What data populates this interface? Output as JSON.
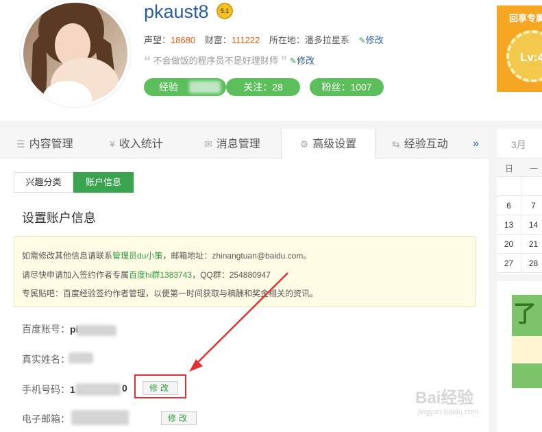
{
  "profile": {
    "username": "pkaust8",
    "level_medal": "5.1",
    "reputation_label": "声望：",
    "reputation_value": "18680",
    "wealth_label": "财富：",
    "wealth_value": "111222",
    "location_label": "所在地：",
    "location_value": "潘多拉星系",
    "edit_label": "修改",
    "motto": "不会做饭的程序员不是好理财师",
    "motto_edit_label": "修改",
    "exp_label": "经验",
    "follow_label": "关注：28",
    "fans_label": "粉丝：1007"
  },
  "badge_card": {
    "title": "回享专属",
    "level": "Lv:4"
  },
  "tabs": [
    {
      "label": "内容管理",
      "icon": "list-icon"
    },
    {
      "label": "收入统计",
      "icon": "yen-icon"
    },
    {
      "label": "消息管理",
      "icon": "mail-icon"
    },
    {
      "label": "高级设置",
      "icon": "gear-icon"
    },
    {
      "label": "经验互动",
      "icon": "exchange-icon"
    }
  ],
  "tabs_more": "»",
  "active_tab": "高级设置",
  "subtabs": [
    {
      "label": "兴趣分类"
    },
    {
      "label": "账户信息"
    }
  ],
  "section_title": "设置账户信息",
  "notice": {
    "line1_a": "如需修改其他信息请联系",
    "line1_b": "管理员du小策",
    "line1_c": "，邮箱地址：zhinangtuan@baidu.com。",
    "line2_a": "请尽快申请加入签约作者专属",
    "line2_b": "百度hi群1383743",
    "line2_c": "，QQ群：254880947",
    "line3": "专属贴吧：百度经验签约作者管理，以便第一时间获取与稿酬和奖金相关的资讯。"
  },
  "fields": {
    "baidu_account_label": "百度账号：",
    "baidu_account_value": "pi",
    "real_name_label": "真实姓名：",
    "phone_label": "手机号码：",
    "phone_value_start": "1",
    "phone_value_end": "0",
    "email_label": "电子邮箱：",
    "edit_button": "修改"
  },
  "calendar": {
    "month": "3月",
    "weekdays": [
      "日",
      "一"
    ],
    "rows": [
      [
        "",
        ""
      ],
      [
        "6",
        "7"
      ],
      [
        "13",
        "14"
      ],
      [
        "20",
        "21"
      ],
      [
        "27",
        "28"
      ]
    ]
  },
  "ad": {
    "text": "了不"
  },
  "watermark": {
    "main": "Bai经验",
    "sub": "jingyan.baidu.com"
  },
  "colors": {
    "accent_green": "#3aa350",
    "pill_green": "#5cbf5c",
    "link_blue": "#2b5ea0",
    "highlight_red": "#e53030",
    "badge_orange": "#f5a623"
  }
}
